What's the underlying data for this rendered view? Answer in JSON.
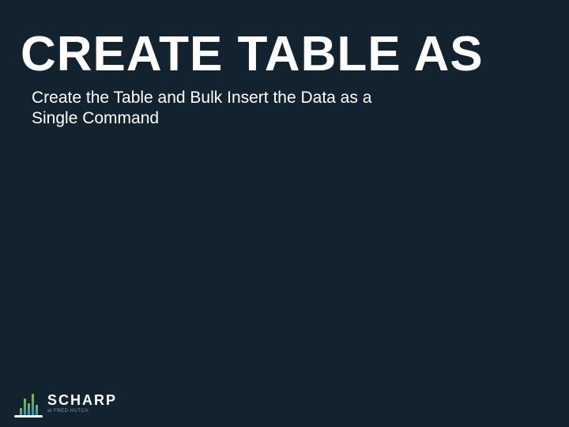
{
  "slide": {
    "title": "CREATE TABLE AS",
    "subtitle": "Create the Table and Bulk Insert the Data as a Single Command"
  },
  "footer": {
    "logo_name": "SCHARP",
    "logo_sub": "at FRED HUTCH"
  },
  "colors": {
    "background": "#13222f",
    "text": "#ffffff"
  }
}
